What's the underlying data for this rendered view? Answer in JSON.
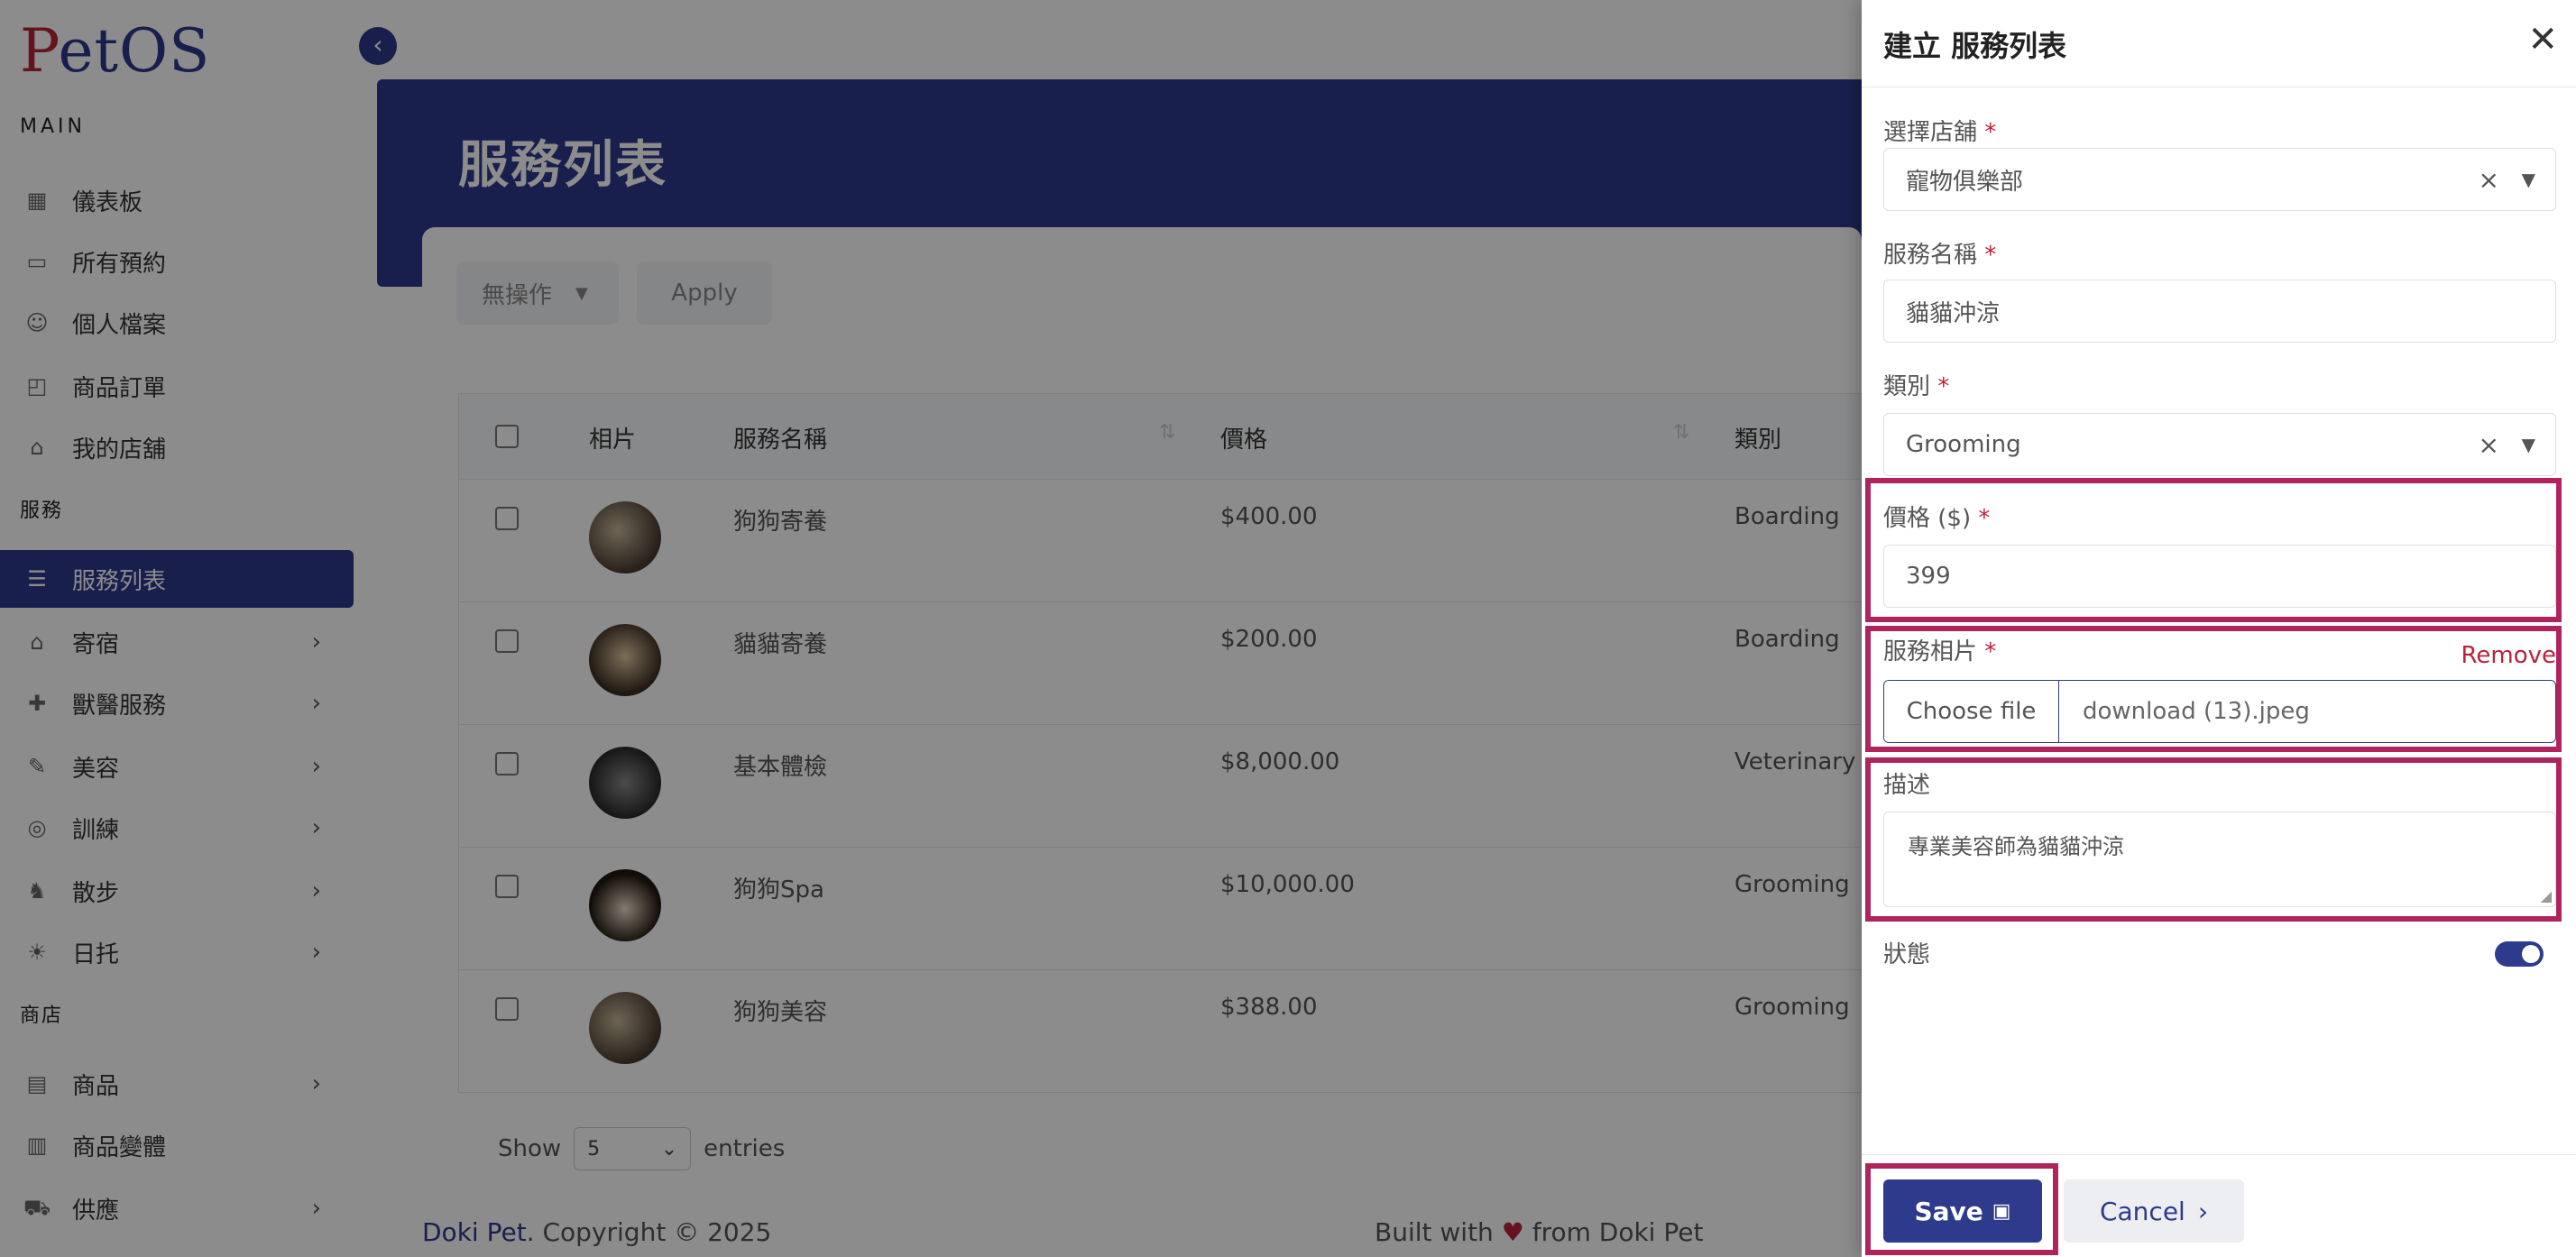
{
  "app": {
    "logo_p": "P",
    "logo_rest": "etOS"
  },
  "sidebar": {
    "section_main": "MAIN",
    "section_services": "服務",
    "section_shop": "商店",
    "items": [
      {
        "label": "儀表板",
        "icon": "dashboard-icon"
      },
      {
        "label": "所有預約",
        "icon": "calendar-icon"
      },
      {
        "label": "個人檔案",
        "icon": "user-icon"
      },
      {
        "label": "商品訂單",
        "icon": "bag-icon"
      },
      {
        "label": "我的店舖",
        "icon": "store-icon"
      },
      {
        "label": "服務列表",
        "icon": "list-icon",
        "active": true
      },
      {
        "label": "寄宿",
        "icon": "home-icon"
      },
      {
        "label": "獸醫服務",
        "icon": "vet-icon"
      },
      {
        "label": "美容",
        "icon": "brush-icon"
      },
      {
        "label": "訓練",
        "icon": "training-icon"
      },
      {
        "label": "散步",
        "icon": "walk-icon"
      },
      {
        "label": "日托",
        "icon": "daycare-icon"
      },
      {
        "label": "商品",
        "icon": "shop-icon"
      },
      {
        "label": "商品變體",
        "icon": "variant-icon"
      },
      {
        "label": "供應",
        "icon": "truck-icon"
      }
    ]
  },
  "main": {
    "page_title": "服務列表",
    "bulk_action": "無操作",
    "apply": "Apply",
    "table": {
      "headers": [
        "相片",
        "服務名稱",
        "價格",
        "類別"
      ],
      "rows": [
        {
          "name": "狗狗寄養",
          "price": "$400.00",
          "category": "Boarding"
        },
        {
          "name": "貓貓寄養",
          "price": "$200.00",
          "category": "Boarding"
        },
        {
          "name": "基本體檢",
          "price": "$8,000.00",
          "category": "Veterinary"
        },
        {
          "name": "狗狗Spa",
          "price": "$10,000.00",
          "category": "Grooming"
        },
        {
          "name": "狗狗美容",
          "price": "$388.00",
          "category": "Grooming"
        }
      ]
    },
    "show": "Show",
    "entries_value": "5",
    "entries": "entries"
  },
  "footer": {
    "brand": "Doki Pet",
    "copyright": ". Copyright © 2025",
    "built_pre": "Built with",
    "built_post": "from Doki Pet"
  },
  "panel": {
    "title": "建立 服務列表",
    "store_label": "選擇店舖",
    "store_value": "寵物俱樂部",
    "name_label": "服務名稱",
    "name_value": "貓貓沖涼",
    "category_label": "類別",
    "category_value": "Grooming",
    "price_label": "價格 ($)",
    "price_value": "399",
    "photo_label": "服務相片",
    "remove": "Remove",
    "choose_file": "Choose file",
    "file_name": "download (13).jpeg",
    "desc_label": "描述",
    "desc_value": "專業美容師為貓貓沖涼",
    "status_label": "狀態",
    "save": "Save",
    "cancel": "Cancel"
  },
  "colors": {
    "accent": "#2e3a8c",
    "highlight": "#b0245e",
    "danger": "#b8233a"
  }
}
